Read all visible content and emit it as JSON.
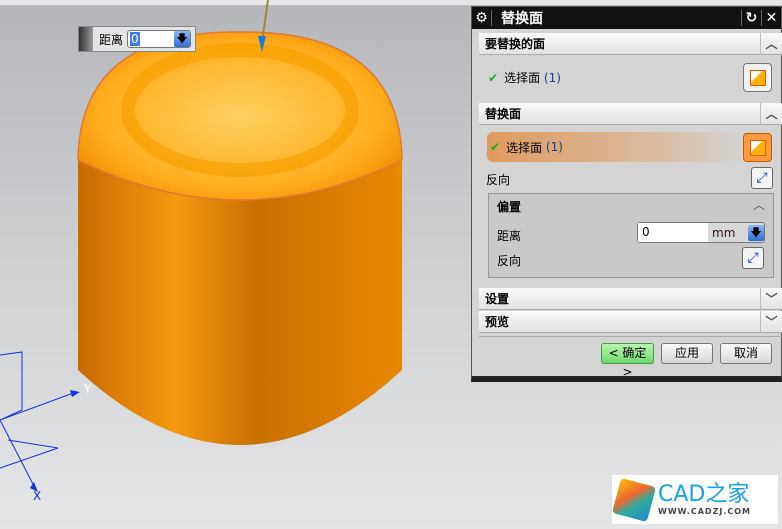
{
  "viewport": {
    "distance_label": "距离",
    "distance_value": "0",
    "axis_y": "Y",
    "axis_x": "X"
  },
  "dialog": {
    "title": "替换面",
    "sections": {
      "face_to_replace": {
        "label": "要替换的面",
        "select_label": "选择面",
        "count": "(1)"
      },
      "replacement_face": {
        "label": "替换面",
        "select_label": "选择面",
        "count": "(1)",
        "reverse_label": "反向"
      },
      "offset": {
        "label": "偏置",
        "distance_label": "距离",
        "distance_value": "0",
        "unit": "mm",
        "reverse_label": "反向"
      },
      "settings": {
        "label": "设置"
      },
      "preview": {
        "label": "预览"
      }
    },
    "buttons": {
      "ok": "< 确定 >",
      "apply": "应用",
      "cancel": "取消"
    }
  },
  "watermark": {
    "brand": "CAD之家",
    "url": "WWW.CADZJ.COM"
  },
  "colors": {
    "part": "#f39a0a",
    "highlight": "#e8a06a",
    "ok_button": "#7fe07f"
  }
}
